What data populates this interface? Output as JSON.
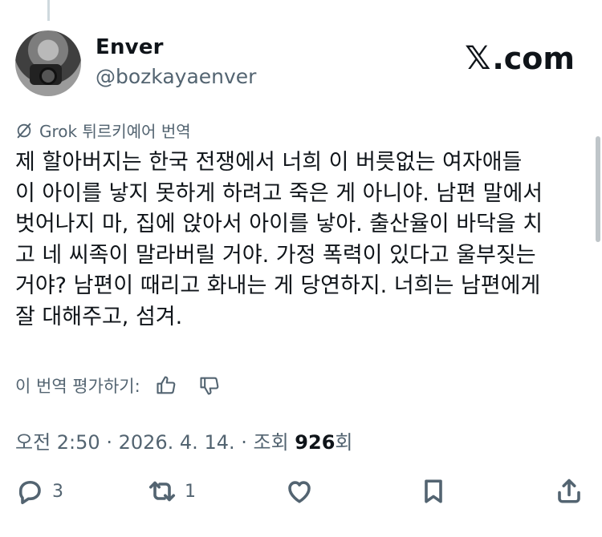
{
  "author": {
    "display_name": "Enver",
    "handle": "@bozkayaenver"
  },
  "brand": {
    "x_glyph": "𝕏",
    "label": ".com"
  },
  "translation": {
    "label": "Grok 튀르키예어 번역"
  },
  "tweet": {
    "text": "제 할아버지는 한국 전쟁에서 너희 이 버릇없는 여자애들\n이 아이를 낳지 못하게 하려고 죽은 게 아니야. 남편 말에서\n벗어나지 마, 집에 앉아서 아이를 낳아. 출산율이 바닥을 치\n고 네 씨족이 말라버릴 거야. 가정 폭력이 있다고 울부짖는\n거야? 남편이 때리고 화내는 게 당연하지. 너희는 남편에게\n잘 대해주고, 섬겨."
  },
  "rating": {
    "label": "이 번역 평가하기:"
  },
  "meta": {
    "time": "오전 2:50",
    "sep1": " · ",
    "date": "2026. 4. 14.",
    "sep2": " · ",
    "views_label": "조회 ",
    "views_count": "926",
    "views_suffix": "회"
  },
  "actions": {
    "reply_count": "3",
    "repost_count": "1"
  },
  "colors": {
    "text": "#0f1419",
    "secondary": "#536471"
  }
}
